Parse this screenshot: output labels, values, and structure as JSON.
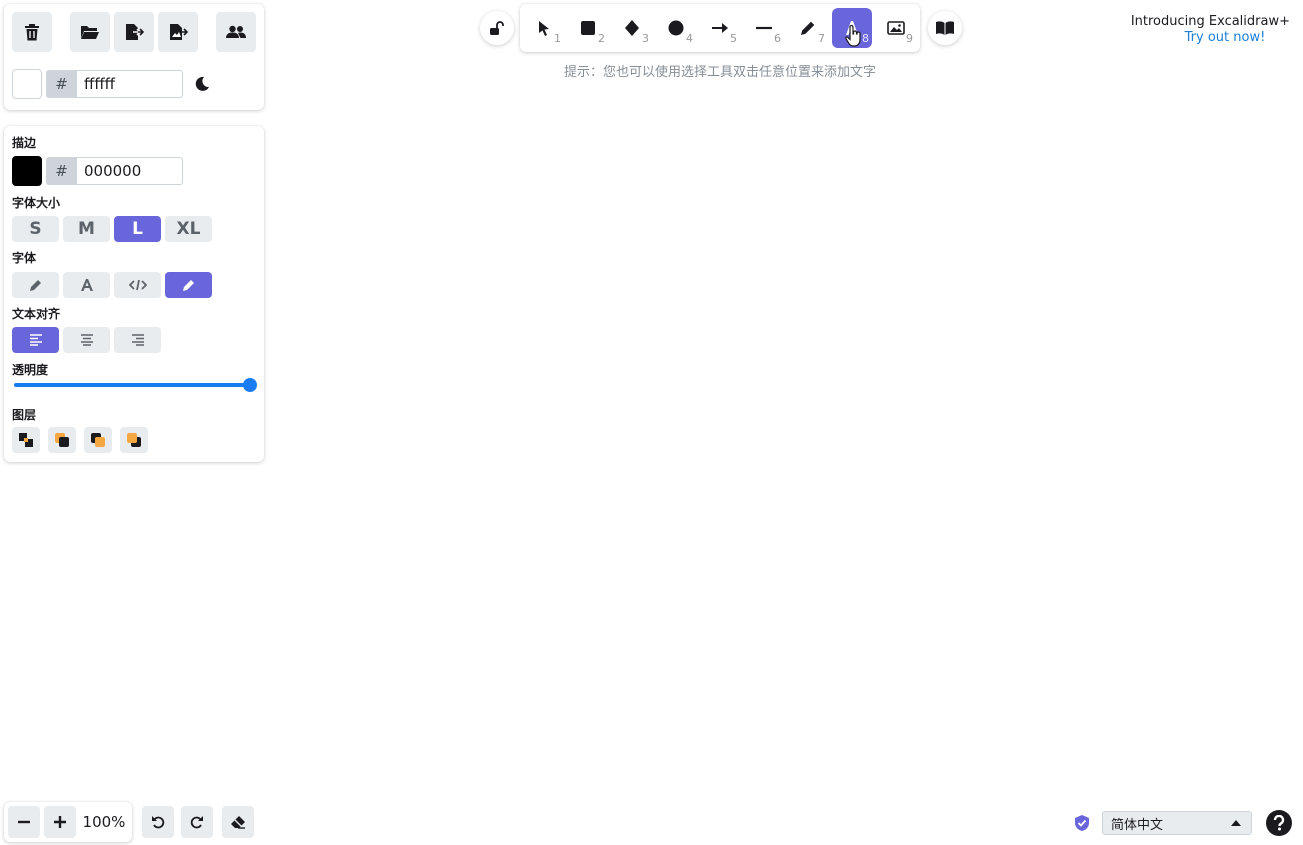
{
  "toolbar": {
    "hint": "提示：您也可以使用选择工具双击任意位置来添加文字",
    "tools": [
      {
        "icon": "selection-arrow-icon",
        "num": "1"
      },
      {
        "icon": "rectangle-icon",
        "num": "2"
      },
      {
        "icon": "diamond-icon",
        "num": "3"
      },
      {
        "icon": "ellipse-icon",
        "num": "4"
      },
      {
        "icon": "arrow-icon",
        "num": "5"
      },
      {
        "icon": "line-icon",
        "num": "6"
      },
      {
        "icon": "pencil-draw-icon",
        "num": "7"
      },
      {
        "icon": "text-icon",
        "num": "8"
      },
      {
        "icon": "image-icon",
        "num": "9"
      }
    ],
    "active_tool_num": "8"
  },
  "promo": {
    "title": "Introducing Excalidraw+",
    "link": "Try out now!"
  },
  "canvas_panel": {
    "background_hex": "ffffff"
  },
  "props_panel": {
    "stroke_label": "描边",
    "stroke_hex": "000000",
    "font_size_label": "字体大小",
    "font_sizes": [
      "S",
      "M",
      "L",
      "XL"
    ],
    "font_size_selected": "L",
    "font_family_label": "字体",
    "text_align_label": "文本对齐",
    "opacity_label": "透明度",
    "opacity": 100,
    "layers_label": "图层"
  },
  "footer": {
    "zoom": "100%",
    "language": "简体中文"
  },
  "colors": {
    "accent": "#6965db",
    "button_bg": "#e9ecef",
    "slider": "#1a7cf2",
    "layer_orange": "#f5a742"
  }
}
